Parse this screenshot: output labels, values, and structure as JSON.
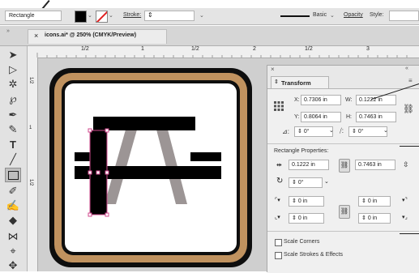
{
  "control_bar": {
    "object_type": "Rectangle",
    "stroke_label": "Stroke:",
    "brush_label": "Basic",
    "opacity_label": "Opacity",
    "style_label": "Style:"
  },
  "document": {
    "tab_title": "icons.ai* @ 250% (CMYK/Preview)"
  },
  "ruler": {
    "top_ticks": [
      "1/2",
      "1",
      "1/2",
      "2",
      "1/2",
      "3"
    ],
    "left_ticks": [
      "1/2",
      "1",
      "1/2"
    ]
  },
  "transform_panel": {
    "title": "Transform",
    "x_label": "X:",
    "x_value": "0.7306 in",
    "y_label": "Y:",
    "y_value": "0.8064 in",
    "w_label": "W:",
    "w_value": "0.1222 in",
    "h_label": "H:",
    "h_value": "0.7463 in",
    "rotate_value": "0°",
    "shear_value": "0°",
    "rect_props_title": "Rectangle Properties:",
    "rect_width": "0.1222 in",
    "rect_height": "0.7463 in",
    "rect_angle": "0°",
    "corner_tl": "0 in",
    "corner_tr": "0 in",
    "corner_bl": "0 in",
    "corner_br": "0 in",
    "scale_corners": "Scale Corners",
    "scale_strokes": "Scale Strokes & Effects"
  },
  "colors": {
    "artboard_frame": "#c0925f",
    "selection": "#d14a8e",
    "fill": "#000000",
    "leg_gray": "#9c9595"
  }
}
